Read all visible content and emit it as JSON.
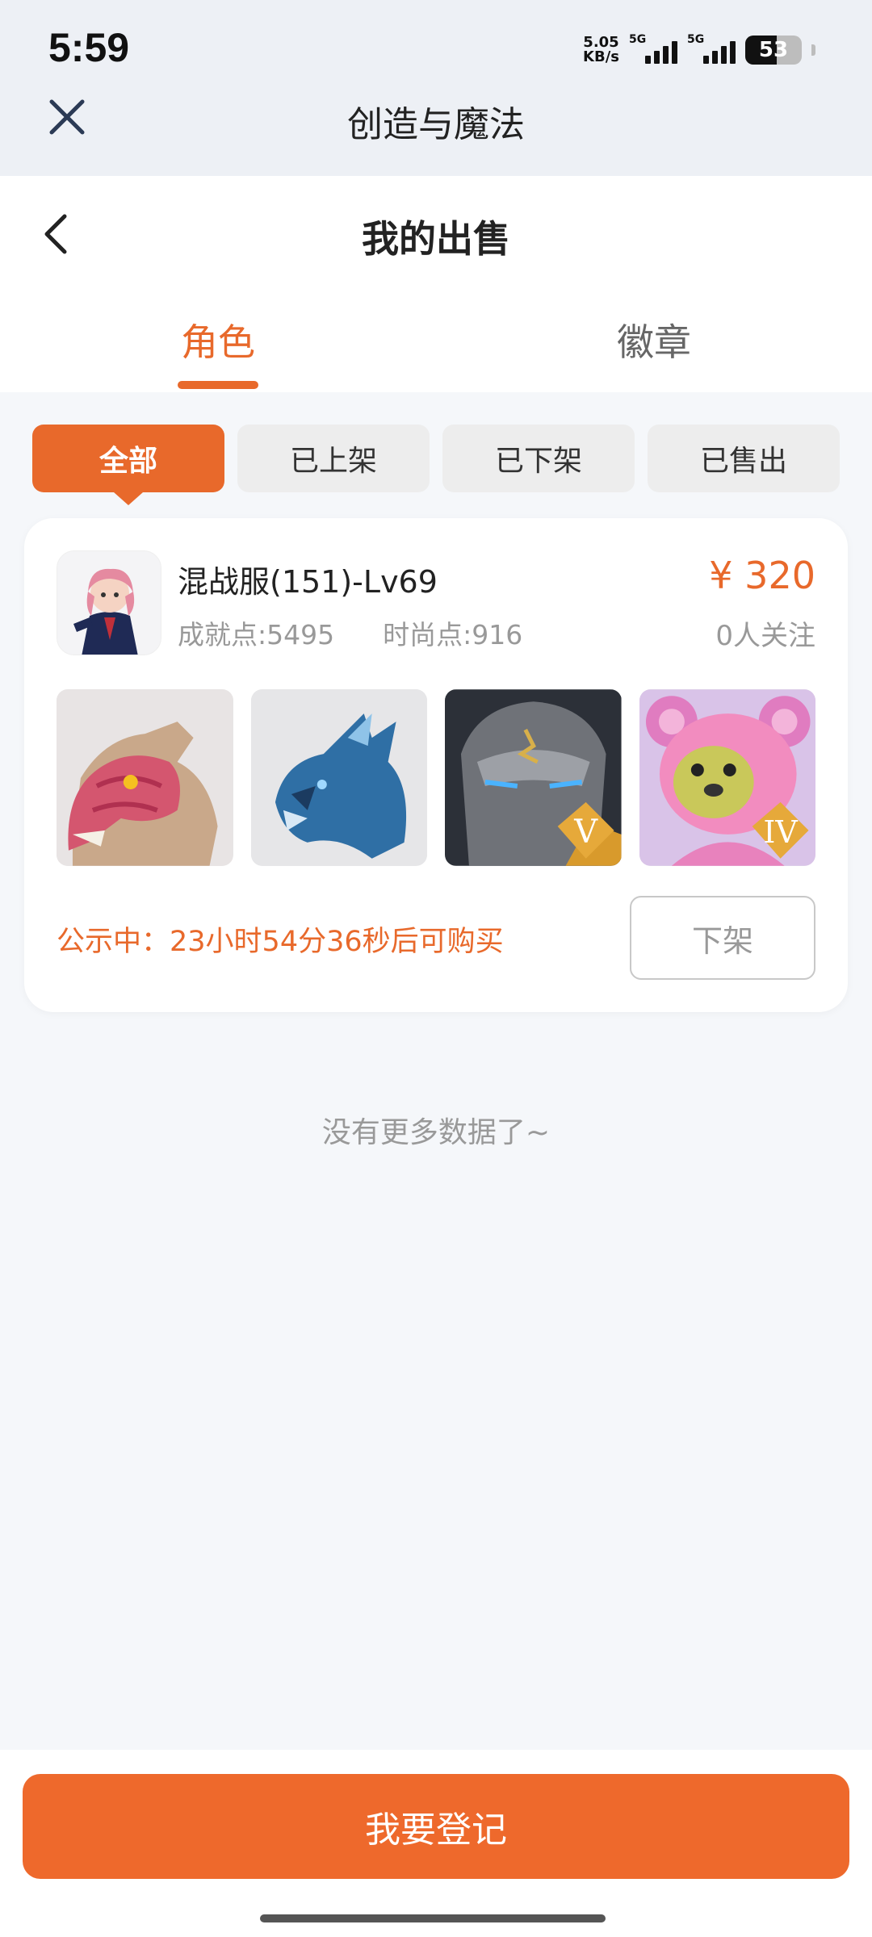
{
  "status": {
    "time": "5:59",
    "net_speed_top": "5.05",
    "net_speed_bottom": "KB/s",
    "sim1": "5G",
    "sim2": "5G",
    "battery": "53"
  },
  "miniapp": {
    "title": "创造与魔法"
  },
  "header": {
    "title": "我的出售",
    "tabs": [
      {
        "label": "角色"
      },
      {
        "label": "徽章"
      }
    ]
  },
  "filters": [
    {
      "label": "全部"
    },
    {
      "label": "已上架"
    },
    {
      "label": "已下架"
    },
    {
      "label": "已售出"
    }
  ],
  "listing": {
    "name": "混战服(151)-Lv69",
    "achievement": "成就点:5495",
    "fashion": "时尚点:916",
    "price": "¥ 320",
    "followers": "0人关注",
    "items": [
      {
        "name": "pink-dragon-mount",
        "badge": ""
      },
      {
        "name": "blue-ice-dragon-mount",
        "badge": ""
      },
      {
        "name": "stone-golem-pet",
        "badge": "V"
      },
      {
        "name": "pink-bear-pet",
        "badge": "IV"
      }
    ],
    "notice_prefix": "公示中：",
    "notice_time": "23小时54分36秒后可购买",
    "delist_label": "下架"
  },
  "footer_text": "没有更多数据了~",
  "register_label": "我要登记",
  "colors": {
    "accent": "#e8692b",
    "page_bg": "#f5f7fa"
  }
}
